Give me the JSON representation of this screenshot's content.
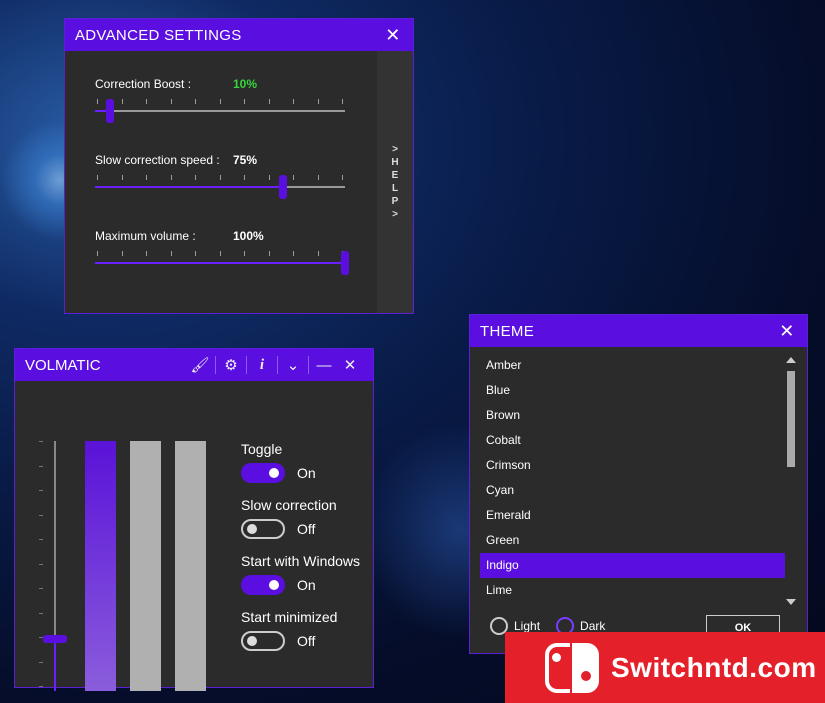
{
  "advanced": {
    "title": "ADVANCED SETTINGS",
    "close": "✕",
    "help": [
      ">",
      "H",
      "E",
      "L",
      "P",
      ">"
    ],
    "sliders": [
      {
        "label": "Correction Boost :",
        "value": "10%",
        "value_color": "#37d43a",
        "fraction": 0.06
      },
      {
        "label": "Slow correction speed :",
        "value": "75%",
        "value_color": "#ffffff",
        "fraction": 0.75
      },
      {
        "label": "Maximum volume :",
        "value": "100%",
        "value_color": "#ffffff",
        "fraction": 1.0
      }
    ]
  },
  "volmatic": {
    "title": "VOLMATIC",
    "icons": [
      "brush-icon",
      "gear-icon",
      "info-icon",
      "chevron-down-icon"
    ],
    "minimize": "—",
    "close": "✕",
    "level_fraction": 0.21,
    "options": [
      {
        "label": "Toggle",
        "state": "On",
        "on": true
      },
      {
        "label": "Slow correction",
        "state": "Off",
        "on": false
      },
      {
        "label": "Start with Windows",
        "state": "On",
        "on": true
      },
      {
        "label": "Start minimized",
        "state": "Off",
        "on": false
      }
    ]
  },
  "theme": {
    "title": "THEME",
    "close": "✕",
    "items": [
      "Amber",
      "Blue",
      "Brown",
      "Cobalt",
      "Crimson",
      "Cyan",
      "Emerald",
      "Green",
      "Indigo",
      "Lime"
    ],
    "selected": "Indigo",
    "light_label": "Light",
    "dark_label": "Dark",
    "ok_label": "OK"
  },
  "watermark": {
    "text": "Switchntd.com"
  },
  "colors": {
    "accent": "#5a0fe0",
    "panel": "#2b2b2b",
    "watermark": "#e4212b"
  }
}
